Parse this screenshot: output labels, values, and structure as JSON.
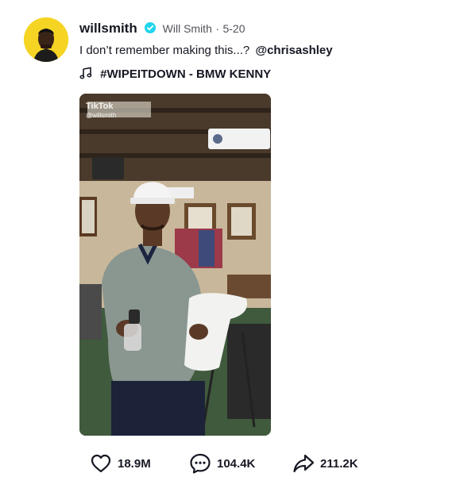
{
  "author": {
    "username": "willsmith",
    "nickname": "Will Smith",
    "separator": "·",
    "date": "5-20",
    "verified": true
  },
  "caption": {
    "text": "I don’t remember making this...?",
    "mention": "@chrisashley"
  },
  "music": {
    "title": "#WIPEITDOWN - BMW KENNY",
    "icon": "music-note-icon"
  },
  "video": {
    "watermark_logo": "TikTok",
    "watermark_handle": "@willsmith"
  },
  "stats": {
    "likes": "18.9M",
    "comments": "104.4K",
    "shares": "211.2K"
  },
  "colors": {
    "avatar_bg": "#f5d423",
    "verified": "#20d5ec",
    "text": "#161823"
  }
}
